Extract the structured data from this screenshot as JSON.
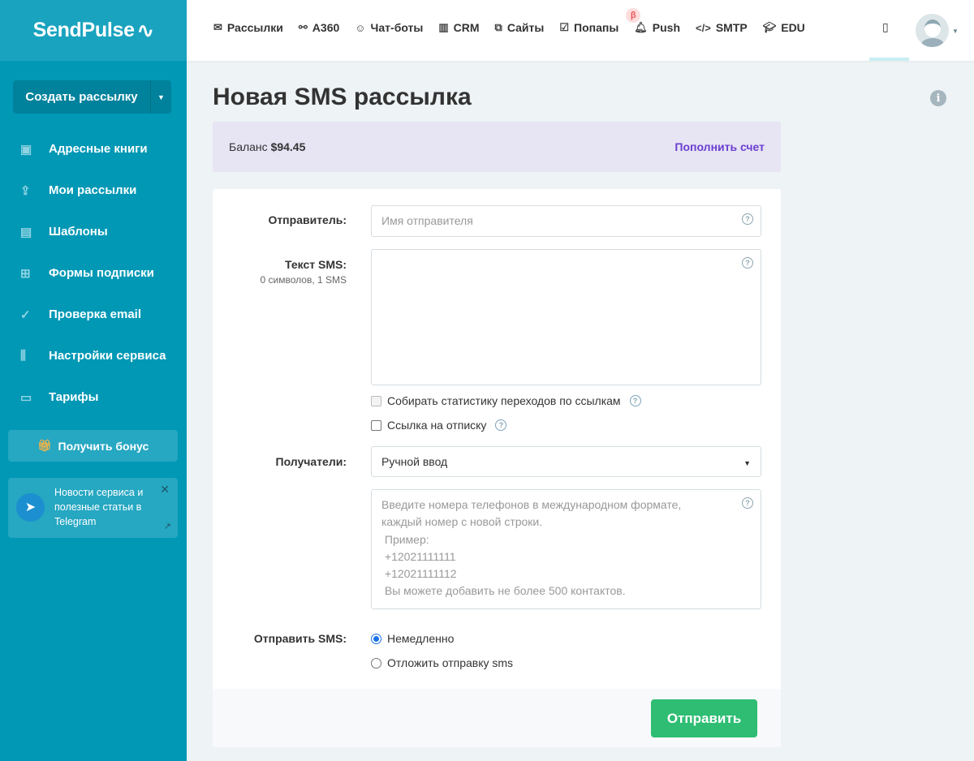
{
  "logo": "SendPulse",
  "sidebar": {
    "create_label": "Создать рассылку",
    "items": [
      {
        "label": "Адресные книги",
        "icon": "address-book-icon"
      },
      {
        "label": "Мои рассылки",
        "icon": "upload-tray-icon"
      },
      {
        "label": "Шаблоны",
        "icon": "template-icon"
      },
      {
        "label": "Формы подписки",
        "icon": "form-icon"
      },
      {
        "label": "Проверка email",
        "icon": "check-icon"
      },
      {
        "label": "Настройки сервиса",
        "icon": "sliders-icon"
      },
      {
        "label": "Тарифы",
        "icon": "wallet-icon"
      }
    ],
    "bonus_label": "Получить бонус",
    "telegram_text": "Новости сервиса и полезные статьи в Telegram"
  },
  "topnav": {
    "items": [
      {
        "label": "Рассылки",
        "icon": "✉"
      },
      {
        "label": "A360",
        "icon": "⚯"
      },
      {
        "label": "Чат-боты",
        "icon": "☺"
      },
      {
        "label": "CRM",
        "icon": "▥"
      },
      {
        "label": "Сайты",
        "icon": "⧉"
      },
      {
        "label": "Попапы",
        "icon": "☑"
      },
      {
        "label": "Push",
        "icon": "🔔︎"
      },
      {
        "label": "SMTP",
        "icon": "</>"
      },
      {
        "label": "EDU",
        "icon": "🎓︎"
      }
    ],
    "beta_badge": "β"
  },
  "page": {
    "title": "Новая SMS рассылка",
    "balance_label": "Баланс",
    "balance_value": "$94.45",
    "topup_link": "Пополнить счет"
  },
  "form": {
    "sender_label": "Отправитель:",
    "sender_placeholder": "Имя отправителя",
    "text_label": "Текст SMS:",
    "text_counter": "0 символов, 1 SMS",
    "text_value": "",
    "track_links_label": "Собирать статистику переходов по ссылкам",
    "unsubscribe_label": "Ссылка на отписку",
    "recipients_label": "Получатели:",
    "recipients_value": "Ручной ввод",
    "phones_placeholder": "Введите номера телефонов в международном формате,\nкаждый номер с новой строки.\n Пример:\n +12021111111\n +12021111112\n Вы можете добавить не более 500 контактов.",
    "send_label": "Отправить SMS:",
    "send_now": "Немедленно",
    "send_later": "Отложить отправку sms",
    "submit": "Отправить"
  }
}
